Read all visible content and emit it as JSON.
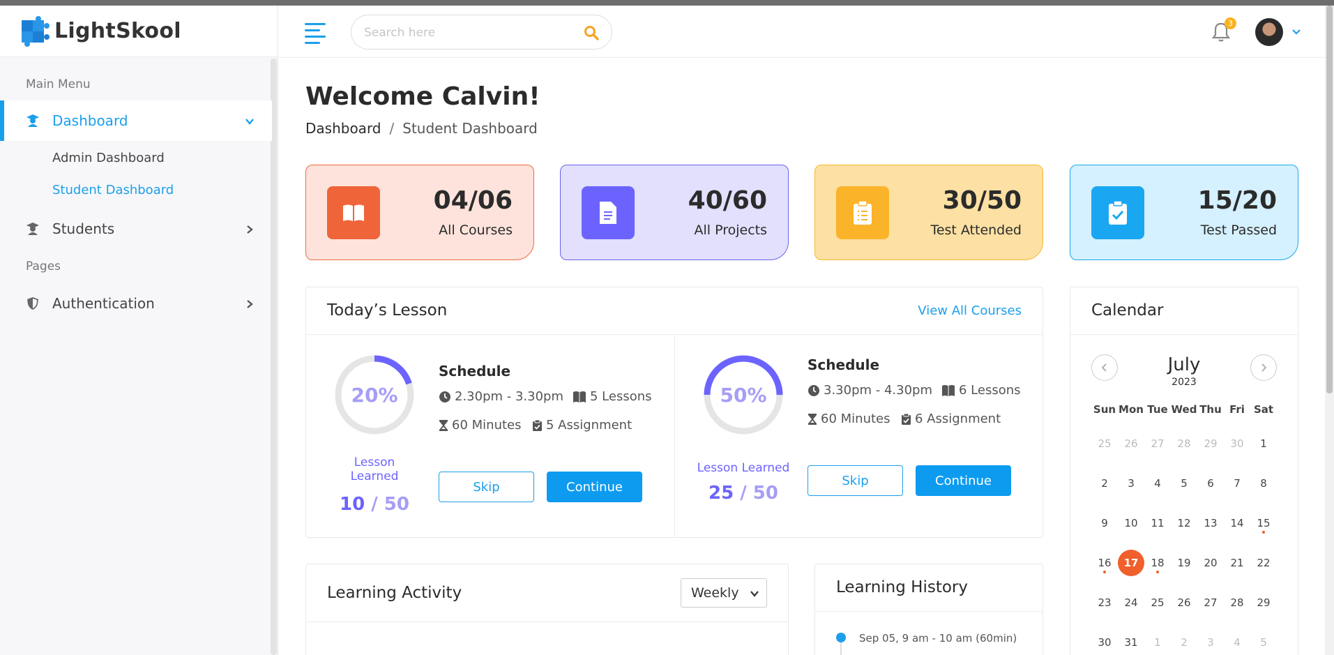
{
  "brand": {
    "name": "LightSkool"
  },
  "search": {
    "placeholder": "Search here"
  },
  "header": {
    "notification_count": "3"
  },
  "sidebar": {
    "main_menu_title": "Main Menu",
    "dashboard_label": "Dashboard",
    "submenu": [
      "Admin Dashboard",
      "Student Dashboard"
    ],
    "students_label": "Students",
    "pages_title": "Pages",
    "auth_label": "Authentication"
  },
  "page": {
    "title": "Welcome Calvin!",
    "breadcrumb_root": "Dashboard",
    "breadcrumb_sep": "/",
    "breadcrumb_current": "Student Dashboard"
  },
  "stats": [
    {
      "value": "04/06",
      "label": "All Courses",
      "icon": "book-icon",
      "bg": "#fde3dc",
      "border": "#f06a3f",
      "icon_bg": "#f0643a"
    },
    {
      "value": "40/60",
      "label": "All Projects",
      "icon": "file-icon",
      "bg": "#e2e0fd",
      "border": "#6b63ee",
      "icon_bg": "#6c63ff"
    },
    {
      "value": "30/50",
      "label": "Test Attended",
      "icon": "clipboard-list-icon",
      "bg": "#fde0a3",
      "border": "#f7b72b",
      "icon_bg": "#fbb32a"
    },
    {
      "value": "15/20",
      "label": "Test Passed",
      "icon": "clipboard-check-icon",
      "bg": "#d5f0fe",
      "border": "#1aa7ee",
      "icon_bg": "#1aa7f2"
    }
  ],
  "lessons_card": {
    "title": "Today’s Lesson",
    "view_all": "View All Courses",
    "lessons": [
      {
        "percent": 0.2,
        "percent_text": "20%",
        "learned_label": "Lesson Learned",
        "learned": "10",
        "sep": " / ",
        "total": "50",
        "schedule_title": "Schedule",
        "time": "2.30pm - 3.30pm",
        "lessons": "5 Lessons",
        "minutes": "60 Minutes",
        "assignment": "5 Assignment",
        "skip": "Skip",
        "continue": "Continue"
      },
      {
        "percent": 0.5,
        "percent_text": "50%",
        "learned_label": "Lesson Learned",
        "learned": "25",
        "sep": " / ",
        "total": "50",
        "schedule_title": "Schedule",
        "time": "3.30pm - 4.30pm",
        "lessons": "6 Lessons",
        "minutes": "60 Minutes",
        "assignment": "6 Assignment",
        "skip": "Skip",
        "continue": "Continue"
      }
    ]
  },
  "activity_card": {
    "title": "Learning Activity",
    "period": "Weekly"
  },
  "history_card": {
    "title": "Learning History",
    "items": [
      "Sep 05, 9 am - 10 am (60min)"
    ]
  },
  "calendar": {
    "title": "Calendar",
    "month": "July",
    "year": "2023",
    "weekdays": [
      "Sun",
      "Mon",
      "Tue",
      "Wed",
      "Thu",
      "Fri",
      "Sat"
    ],
    "weeks": [
      [
        {
          "d": "25",
          "m": true
        },
        {
          "d": "26",
          "m": true
        },
        {
          "d": "27",
          "m": true
        },
        {
          "d": "28",
          "m": true
        },
        {
          "d": "29",
          "m": true
        },
        {
          "d": "30",
          "m": true
        },
        {
          "d": "1"
        }
      ],
      [
        {
          "d": "2"
        },
        {
          "d": "3"
        },
        {
          "d": "4"
        },
        {
          "d": "5"
        },
        {
          "d": "6"
        },
        {
          "d": "7"
        },
        {
          "d": "8"
        }
      ],
      [
        {
          "d": "9"
        },
        {
          "d": "10"
        },
        {
          "d": "11"
        },
        {
          "d": "12"
        },
        {
          "d": "13"
        },
        {
          "d": "14"
        },
        {
          "d": "15",
          "dot": true
        }
      ],
      [
        {
          "d": "16",
          "dot": true
        },
        {
          "d": "17",
          "today": true
        },
        {
          "d": "18",
          "dot": true
        },
        {
          "d": "19"
        },
        {
          "d": "20"
        },
        {
          "d": "21"
        },
        {
          "d": "22"
        }
      ],
      [
        {
          "d": "23"
        },
        {
          "d": "24"
        },
        {
          "d": "25"
        },
        {
          "d": "26"
        },
        {
          "d": "27"
        },
        {
          "d": "28"
        },
        {
          "d": "29"
        }
      ],
      [
        {
          "d": "30"
        },
        {
          "d": "31"
        },
        {
          "d": "1",
          "m": true
        },
        {
          "d": "2",
          "m": true
        },
        {
          "d": "3",
          "m": true
        },
        {
          "d": "4",
          "m": true
        },
        {
          "d": "5",
          "m": true
        }
      ]
    ]
  }
}
